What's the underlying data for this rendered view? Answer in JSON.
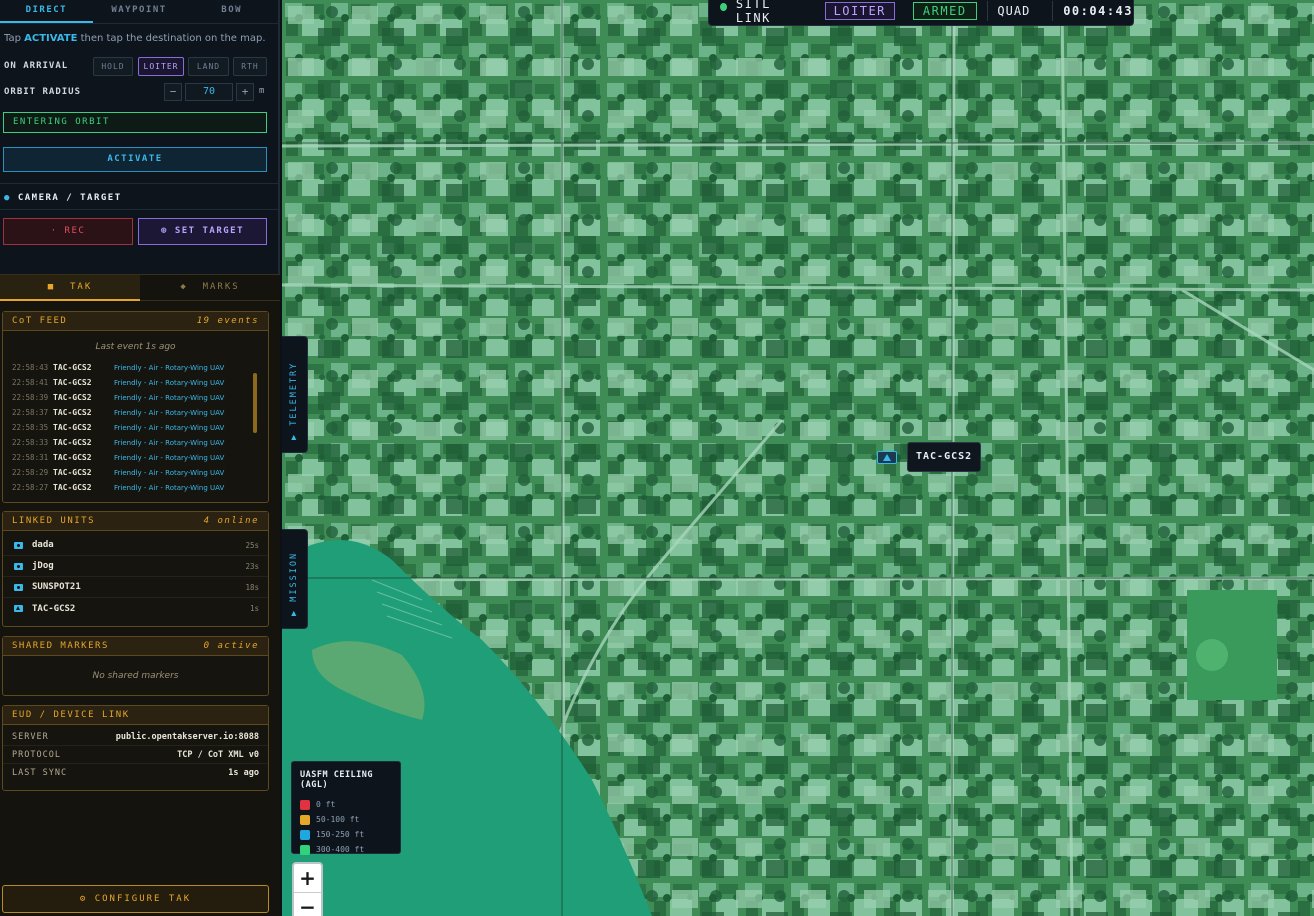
{
  "mode_tabs": [
    "DIRECT",
    "WAYPOINT",
    "BOW"
  ],
  "hint": {
    "pre": "Tap ",
    "keyword": "ACTIVATE",
    "post": " then tap the destination on the map."
  },
  "on_arrival": {
    "label": "ON ARRIVAL",
    "options": [
      "HOLD",
      "LOITER",
      "LAND",
      "RTH"
    ],
    "selected": "LOITER"
  },
  "orbit": {
    "label": "ORBIT RADIUS",
    "value": "70",
    "unit": "m",
    "minus": "−",
    "plus": "+"
  },
  "status": "ENTERING ORBIT",
  "activate_label": "ACTIVATE",
  "camera": {
    "title": "CAMERA / TARGET",
    "rec_label": "· REC",
    "target_label": "⊕ SET TARGET"
  },
  "lower_tabs": [
    {
      "icon": "■",
      "label": "TAK"
    },
    {
      "icon": "◆",
      "label": "MARKS"
    }
  ],
  "cot_feed": {
    "title": "CoT FEED",
    "count": "19 events",
    "last_event": "Last event 1s ago",
    "events": [
      {
        "time": "22:58:43",
        "callsign": "TAC-GCS2",
        "desc": "Friendly - Air - Rotary-Wing UAV"
      },
      {
        "time": "22:58:41",
        "callsign": "TAC-GCS2",
        "desc": "Friendly - Air - Rotary-Wing UAV"
      },
      {
        "time": "22:58:39",
        "callsign": "TAC-GCS2",
        "desc": "Friendly - Air - Rotary-Wing UAV"
      },
      {
        "time": "22:58:37",
        "callsign": "TAC-GCS2",
        "desc": "Friendly - Air - Rotary-Wing UAV"
      },
      {
        "time": "22:58:35",
        "callsign": "TAC-GCS2",
        "desc": "Friendly - Air - Rotary-Wing UAV"
      },
      {
        "time": "22:58:33",
        "callsign": "TAC-GCS2",
        "desc": "Friendly - Air - Rotary-Wing UAV"
      },
      {
        "time": "22:58:31",
        "callsign": "TAC-GCS2",
        "desc": "Friendly - Air - Rotary-Wing UAV"
      },
      {
        "time": "22:58:29",
        "callsign": "TAC-GCS2",
        "desc": "Friendly - Air - Rotary-Wing UAV"
      },
      {
        "time": "22:58:27",
        "callsign": "TAC-GCS2",
        "desc": "Friendly - Air - Rotary-Wing UAV"
      }
    ]
  },
  "linked_units": {
    "title": "LINKED UNITS",
    "count": "4 online",
    "units": [
      {
        "name": "dada",
        "age": "25s",
        "icon": "eud-icon"
      },
      {
        "name": "jDog",
        "age": "23s",
        "icon": "eud-icon"
      },
      {
        "name": "SUNSPOT21",
        "age": "18s",
        "icon": "eud-icon"
      },
      {
        "name": "TAC-GCS2",
        "age": "1s",
        "icon": "uav-icon"
      }
    ]
  },
  "shared_markers": {
    "title": "SHARED MARKERS",
    "count": "0 active",
    "empty": "No shared markers"
  },
  "device_link": {
    "title": "EUD / DEVICE LINK",
    "rows": [
      {
        "key": "SERVER",
        "value": "public.opentakserver.io:8088"
      },
      {
        "key": "PROTOCOL",
        "value": "TCP / CoT XML v0"
      },
      {
        "key": "LAST SYNC",
        "value": "1s ago"
      }
    ]
  },
  "configure_label": "⚙  CONFIGURE TAK",
  "side_tabs": {
    "telemetry": "▶ TELEMETRY",
    "mission": "▶ MISSION"
  },
  "statusbar": {
    "link": "SITL LINK",
    "mode": "LOITER",
    "armed": "ARMED",
    "vehicle": "QUAD",
    "timer": "00:04:43"
  },
  "drone_label": "TAC-GCS2",
  "legend": {
    "title": "UASFM CEILING (AGL)",
    "items": [
      {
        "label": "0 ft",
        "color": "#e0333f"
      },
      {
        "label": "50-100 ft",
        "color": "#e5a62a"
      },
      {
        "label": "150-250 ft",
        "color": "#1fa7e0"
      },
      {
        "label": "300-400 ft",
        "color": "#2fd47a"
      }
    ]
  },
  "zoom": {
    "in": "+",
    "out": "−"
  },
  "colors": {
    "accent": "#3ab8e8",
    "amber": "#e5a62a",
    "ok": "#3fcf7c",
    "purple": "#8a6cd8",
    "danger": "#e2505c"
  }
}
